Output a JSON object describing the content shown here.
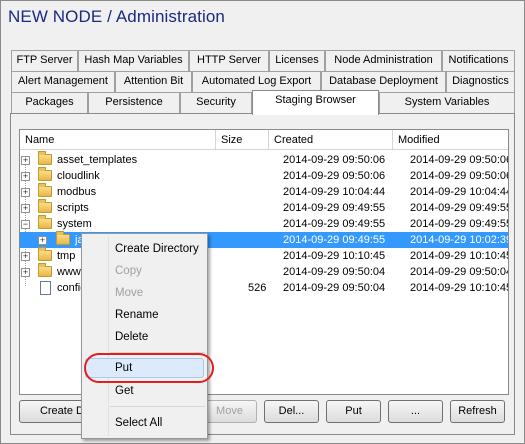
{
  "window": {
    "title": "NEW NODE / Administration"
  },
  "tabs": {
    "row1": [
      "FTP Server",
      "Hash Map Variables",
      "HTTP Server",
      "Licenses",
      "Node Administration",
      "Notifications"
    ],
    "row2": [
      "Alert Management",
      "Attention Bit",
      "Automated Log Export",
      "Database Deployment",
      "Diagnostics"
    ],
    "row3": [
      "Packages",
      "Persistence",
      "Security",
      "Staging Browser",
      "System Variables"
    ],
    "active": "Staging Browser"
  },
  "columns": {
    "name": "Name",
    "size": "Size",
    "created": "Created",
    "modified": "Modified"
  },
  "rows": [
    {
      "name": "asset_templates",
      "size": "",
      "created": "2014-09-29 09:50:06",
      "modified": "2014-09-29 09:50:06",
      "type": "folder",
      "expander": "+"
    },
    {
      "name": "cloudlink",
      "size": "",
      "created": "2014-09-29 09:50:06",
      "modified": "2014-09-29 09:50:06",
      "type": "folder",
      "expander": "+"
    },
    {
      "name": "modbus",
      "size": "",
      "created": "2014-09-29 10:04:44",
      "modified": "2014-09-29 10:04:44",
      "type": "folder",
      "expander": "+"
    },
    {
      "name": "scripts",
      "size": "",
      "created": "2014-09-29 09:49:55",
      "modified": "2014-09-29 09:49:55",
      "type": "folder",
      "expander": "+"
    },
    {
      "name": "system",
      "size": "",
      "created": "2014-09-29 09:49:55",
      "modified": "2014-09-29 09:49:55",
      "type": "folder",
      "expander": "−"
    },
    {
      "name": "ja",
      "size": "",
      "created": "2014-09-29 09:49:55",
      "modified": "2014-09-29 10:02:39",
      "type": "folder",
      "expander": "+",
      "selected": true
    },
    {
      "name": "tmp",
      "size": "",
      "created": "2014-09-29 10:10:45",
      "modified": "2014-09-29 10:10:45",
      "type": "folder",
      "expander": "+"
    },
    {
      "name": "www",
      "size": "",
      "created": "2014-09-29 09:50:04",
      "modified": "2014-09-29 09:50:04",
      "type": "folder",
      "expander": "+"
    },
    {
      "name": "config",
      "size": "526",
      "created": "2014-09-29 09:50:04",
      "modified": "2014-09-29 10:10:45",
      "type": "file",
      "expander": ""
    }
  ],
  "buttons": {
    "create_dir": "Create Dir",
    "move": "Move",
    "delete": "Del...",
    "put": "Put",
    "more": "...",
    "refresh": "Refresh"
  },
  "context_menu": {
    "items": [
      {
        "label": "Create Directory",
        "enabled": true
      },
      {
        "label": "Copy",
        "enabled": false
      },
      {
        "label": "Move",
        "enabled": false
      },
      {
        "label": "Rename",
        "enabled": true
      },
      {
        "label": "Delete",
        "enabled": true
      },
      {
        "label": "Put",
        "enabled": true,
        "highlighted": true
      },
      {
        "label": "Get",
        "enabled": true
      },
      {
        "label": "Select All",
        "enabled": true
      }
    ]
  },
  "colors": {
    "title": "#1a2a80",
    "selection": "#3399ff",
    "annotation": "#e02020"
  }
}
